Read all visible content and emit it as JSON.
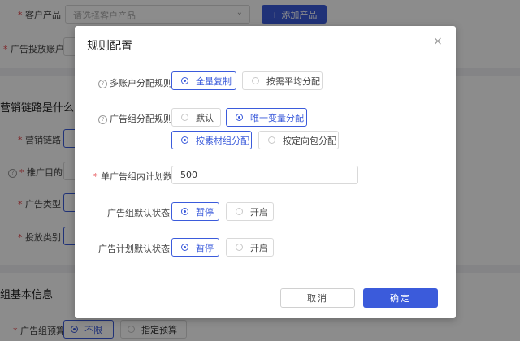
{
  "background": {
    "customer_product_label": "客户产品",
    "customer_product_placeholder": "请选择客户产品",
    "add_product_button": "+ 添加产品",
    "ad_account_label": "广告投放账户",
    "section_marketing": "营销链路是什么",
    "marketing_link_label": "营销链路",
    "promotion_goal_label": "推广目的",
    "ad_type_label": "广告类型",
    "delivery_category_label": "投放类别",
    "section_basic": "组基本信息",
    "ad_group_budget_label": "广告组预算",
    "budget_options": [
      {
        "label": "不限",
        "selected": true
      },
      {
        "label": "指定预算",
        "selected": false
      }
    ]
  },
  "modal": {
    "title": "规则配置",
    "close_icon": "×",
    "multi_account_rule": {
      "label": "多账户分配规则",
      "options": [
        {
          "label": "全量复制",
          "selected": true
        },
        {
          "label": "按需平均分配",
          "selected": false
        }
      ]
    },
    "ad_group_rule": {
      "label": "广告组分配规则",
      "options": [
        {
          "label": "默认",
          "selected": false
        },
        {
          "label": "唯一变量分配",
          "selected": true
        },
        {
          "label": "按素材组分配",
          "selected": true
        },
        {
          "label": "按定向包分配",
          "selected": false
        }
      ]
    },
    "plans_per_group": {
      "label": "单广告组内计划数",
      "value": "500"
    },
    "ad_group_default_status": {
      "label": "广告组默认状态",
      "options": [
        {
          "label": "暂停",
          "selected": true
        },
        {
          "label": "开启",
          "selected": false
        }
      ]
    },
    "ad_plan_default_status": {
      "label": "广告计划默认状态",
      "options": [
        {
          "label": "暂停",
          "selected": true
        },
        {
          "label": "开启",
          "selected": false
        }
      ]
    },
    "cancel_button": "取消",
    "confirm_button": "确定"
  },
  "colors": {
    "primary": "#3b5bdb",
    "required": "#e5484d",
    "overlay": "rgba(0,0,0,0.45)"
  }
}
